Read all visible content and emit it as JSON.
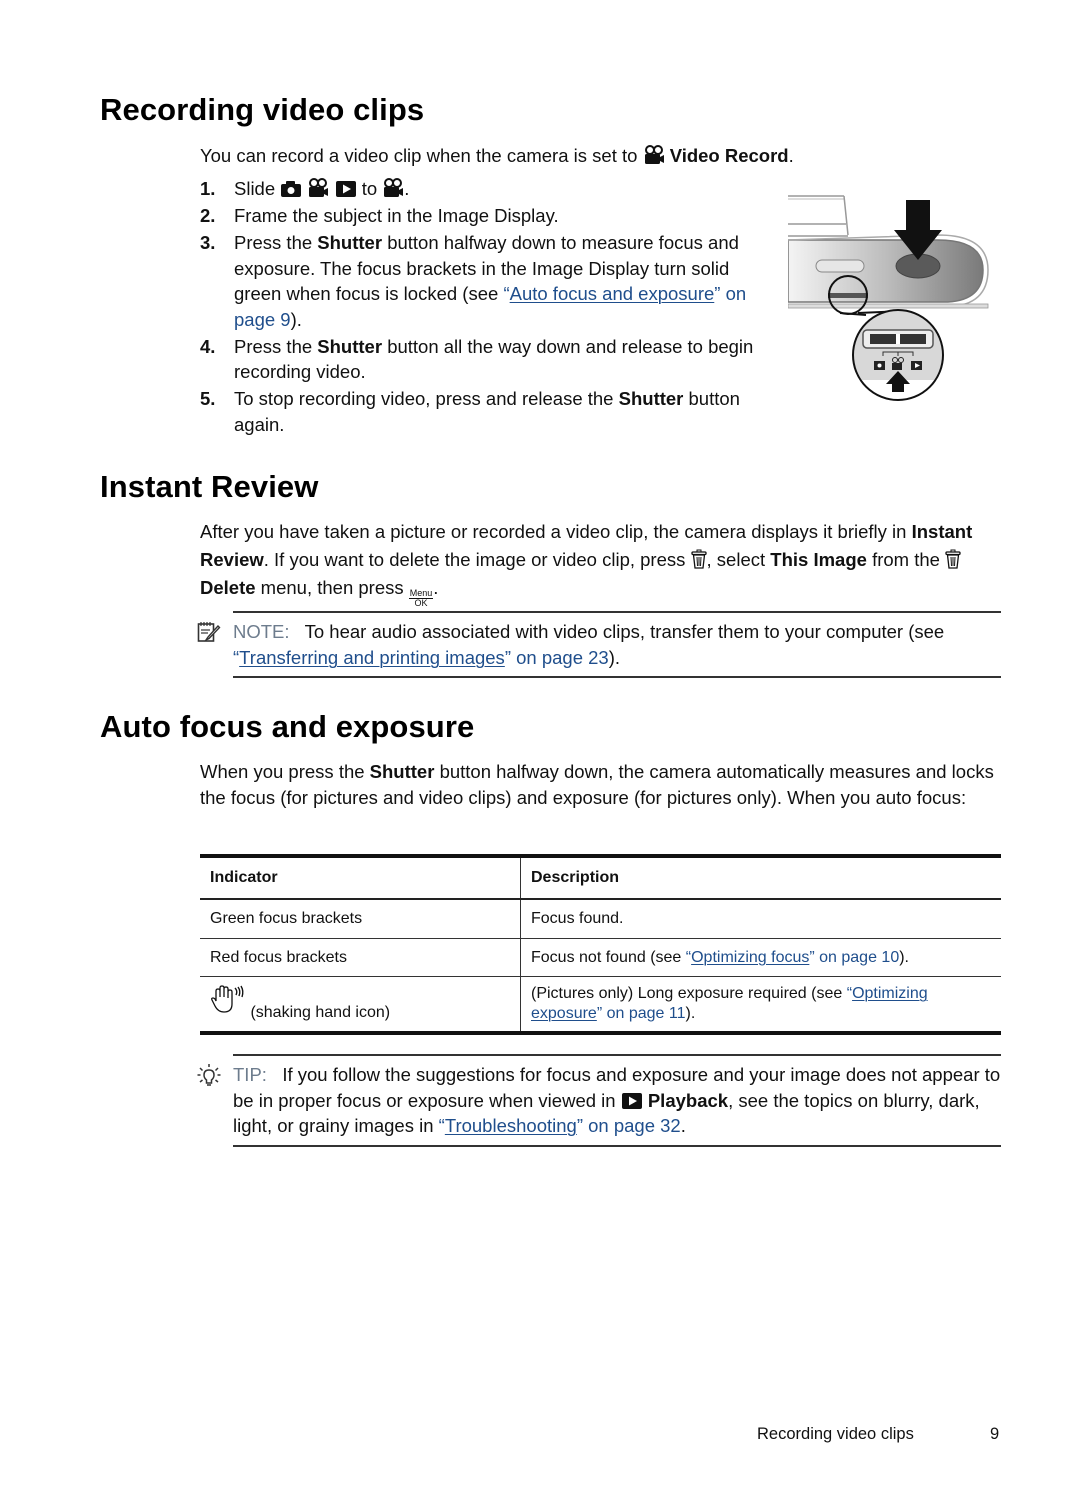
{
  "sections": {
    "recording": {
      "title": "Recording video clips",
      "intro_prefix": "You can record a video clip when the camera is set to",
      "intro_icon": "video-record-icon",
      "intro_bold": "Video Record",
      "intro_suffix": ".",
      "steps": [
        {
          "num": "1.",
          "text_before": "Slide",
          "icons": [
            "camera-icon",
            "video-icon",
            "playback-icon"
          ],
          "text_mid": "to",
          "target_icon": "video-icon",
          "text_after": "."
        },
        {
          "num": "2.",
          "text": "Frame the subject in the Image Display."
        },
        {
          "num": "3.",
          "pre": "Press the",
          "bold": "Shutter",
          "post": "button halfway down to measure focus and exposure. The focus brackets in the Image Display turn solid green when focus is locked (see",
          "link_open_quote": "“",
          "link_text": "Auto focus and exposure",
          "link_close_quote": "”",
          "link_page": "on page 9",
          "tail": ")."
        },
        {
          "num": "4.",
          "pre": "Press the",
          "bold": "Shutter",
          "post": "button all the way down and release to begin recording video."
        },
        {
          "num": "5.",
          "pre": "To stop recording video, press and release the",
          "bold": "Shutter",
          "post": "button again."
        }
      ],
      "illustration": "camera-shutter-mode-switch-illustration"
    },
    "instant_review": {
      "title": "Instant Review",
      "p1": "After you have taken a picture or recorded a video clip, the camera displays it briefly in",
      "bold1": "Instant Review",
      "p2": ". If you want to delete the image or video clip, press",
      "p3": ", select",
      "bold2": "This Image",
      "p4": "from the",
      "bold3": "Delete",
      "p5": "menu, then press",
      "menu_ok_top": "Menu",
      "menu_ok_bottom": "OK",
      "p6": ".",
      "note": {
        "label": "NOTE:",
        "text": "To hear audio associated with video clips, transfer them to your computer (see",
        "link_text": "Transferring and printing images",
        "link_page": "on page 23",
        "tail": ")."
      }
    },
    "auto_focus": {
      "title": "Auto focus and exposure",
      "p1": "When you press the",
      "bold1": "Shutter",
      "p2": "button halfway down, the camera automatically measures and locks the focus (for pictures and video clips) and exposure (for pictures only). When you auto focus:",
      "table": {
        "headers": [
          "Indicator",
          "Description"
        ],
        "rows": [
          {
            "indicator": "Green focus brackets",
            "description": "Focus found."
          },
          {
            "indicator": "Red focus brackets",
            "description_pre": "Focus not found (see",
            "link_text": "Optimizing focus",
            "link_page": "on page 10",
            "tail": ")."
          },
          {
            "indicator_icon": "shaking-hand-icon",
            "indicator": "(shaking hand icon)",
            "description_pre": "(Pictures only) Long exposure required (see",
            "link_text": "Optimizing exposure",
            "link_page": "on page 11",
            "tail": ")."
          }
        ]
      },
      "tip": {
        "label": "TIP:",
        "text1": "If you follow the suggestions for focus and exposure and your image does not appear to be in proper focus or exposure when viewed in",
        "bold": "Playback",
        "text2": ", see the topics on blurry, dark, light, or grainy images in",
        "link_text": "Troubleshooting",
        "link_page": "on page 32",
        "tail": "."
      }
    }
  },
  "footer": {
    "section": "Recording video clips",
    "page": "9"
  },
  "colors": {
    "link": "#1f4e8c",
    "admonition_label": "#6d7c8d",
    "text": "#111111"
  }
}
